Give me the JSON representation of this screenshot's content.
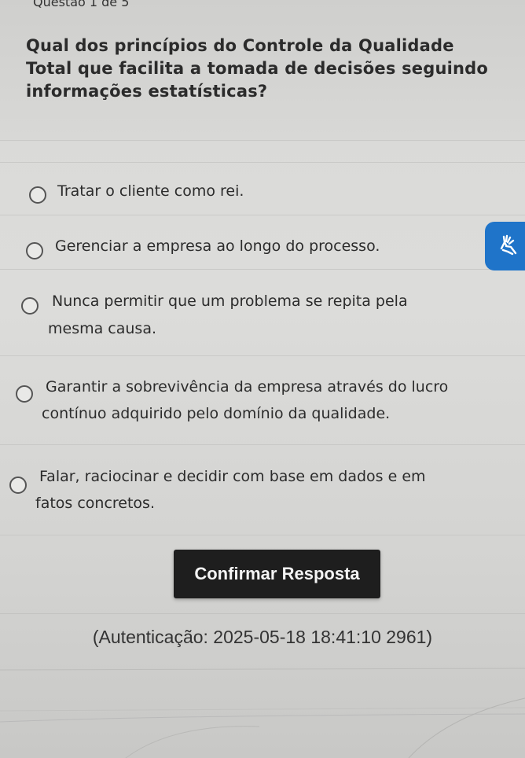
{
  "header": {
    "question_counter": "Questão 1 de 5"
  },
  "question": {
    "text": "Qual dos princípios do Controle da Qualidade Total que facilita a tomada de decisões seguindo informações estatísticas?"
  },
  "options": [
    {
      "line1": "Tratar o cliente como rei.",
      "line2": ""
    },
    {
      "line1": "Gerenciar a empresa ao longo do processo.",
      "line2": ""
    },
    {
      "line1": "Nunca permitir que um problema se repita pela",
      "line2": "mesma causa."
    },
    {
      "line1": "Garantir a sobrevivência da empresa através do lucro",
      "line2": "contínuo adquirido pelo domínio da qualidade."
    },
    {
      "line1": "Falar, raciocinar e decidir com base em dados e em",
      "line2": "fatos concretos."
    }
  ],
  "actions": {
    "confirm_label": "Confirmar Resposta"
  },
  "footer": {
    "authentication": "(Autenticação: 2025-05-18 18:41:10 2961)"
  },
  "widgets": {
    "accessibility_icon": "sign-language-icon",
    "accessibility_color": "#1f74c9"
  }
}
